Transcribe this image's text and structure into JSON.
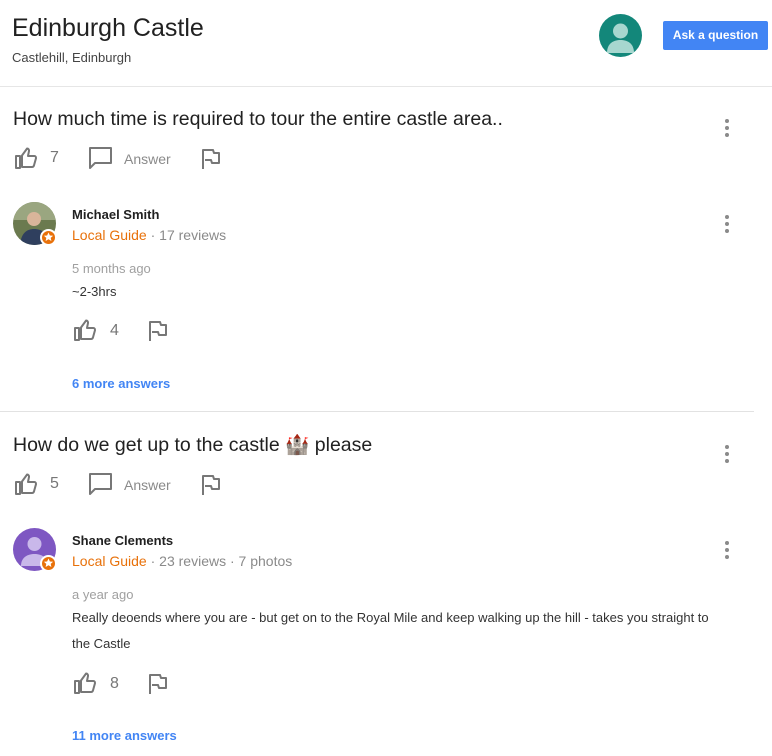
{
  "place": {
    "title": "Edinburgh Castle",
    "address": "Castlehill, Edinburgh"
  },
  "header": {
    "ask_button_label": "Ask a question",
    "avatar_icon": "default-user-avatar"
  },
  "colors": {
    "accent": "#4285f4",
    "local_guide": "#e8710a",
    "avatar_teal": "#13877a",
    "avatar_purple": "#7e57c2"
  },
  "questions": [
    {
      "text": "How much time is required to tour the entire castle area..",
      "likes": "7",
      "answer_label": "Answer",
      "top_answer": {
        "author": "Michael Smith",
        "badge": "Local Guide",
        "separator": "·",
        "reviews": "17 reviews",
        "photos": "",
        "time": "5 months ago",
        "text": "~2-3hrs",
        "likes": "4"
      },
      "more_answers": "6 more answers"
    },
    {
      "text": "How do we get up to the castle 🏰 please",
      "likes": "5",
      "answer_label": "Answer",
      "top_answer": {
        "author": "Shane Clements",
        "badge": "Local Guide",
        "separator": "·",
        "reviews": "23 reviews",
        "photos": "7 photos",
        "time": "a year ago",
        "text": "Really deoends where you are - but get on to the Royal Mile and keep walking up the hill - takes you straight to the Castle",
        "likes": "8"
      },
      "more_answers": "11 more answers"
    }
  ]
}
